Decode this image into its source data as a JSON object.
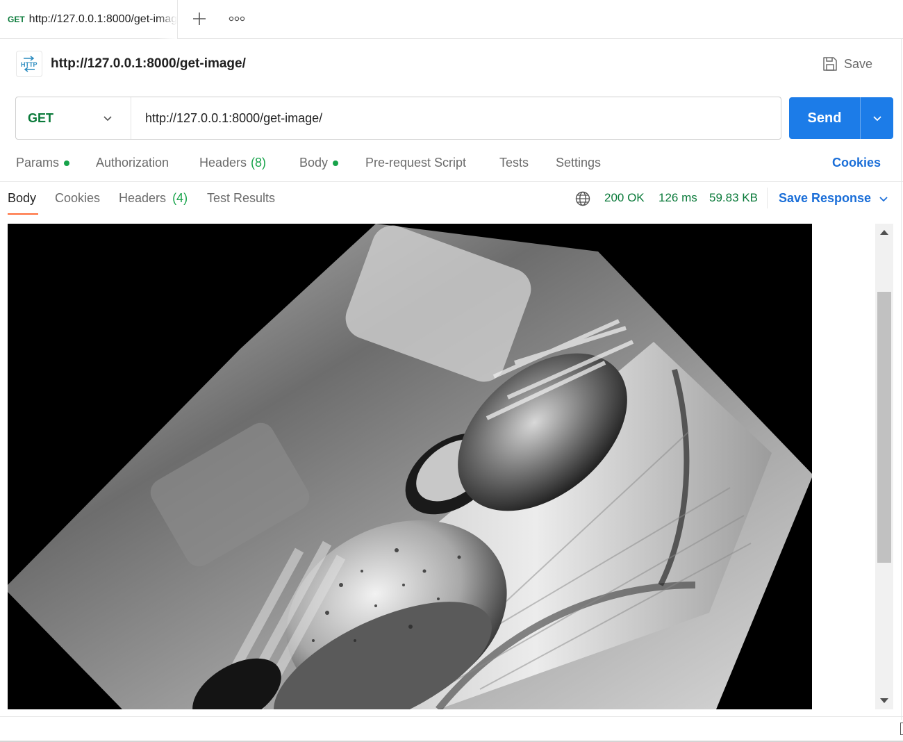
{
  "tab": {
    "method": "GET",
    "title": "http://127.0.0.1:8000/get-image/"
  },
  "tabstrip_icons": [
    "plus-icon",
    "more-horizontal-icon"
  ],
  "request": {
    "name": "http://127.0.0.1:8000/get-image/",
    "save_label": "Save",
    "method": "GET",
    "url": "http://127.0.0.1:8000/get-image/",
    "send_label": "Send"
  },
  "request_tabs": {
    "params": "Params",
    "authorization": "Authorization",
    "headers": "Headers",
    "headers_count": "(8)",
    "body": "Body",
    "prerequest": "Pre-request Script",
    "tests": "Tests",
    "settings": "Settings",
    "cookies": "Cookies"
  },
  "response_tabs": {
    "body": "Body",
    "cookies": "Cookies",
    "headers": "Headers",
    "headers_count": "(4)",
    "test_results": "Test Results"
  },
  "response_status": {
    "status": "200 OK",
    "time": "126 ms",
    "size": "59.83 KB",
    "save_response": "Save Response"
  },
  "colors": {
    "accent_blue": "#1c7ce8",
    "method_green": "#0a7a3a",
    "status_green": "#17a34a",
    "active_tab_orange": "#ff6c37"
  },
  "response_image": {
    "description_icon": "image-preview"
  }
}
